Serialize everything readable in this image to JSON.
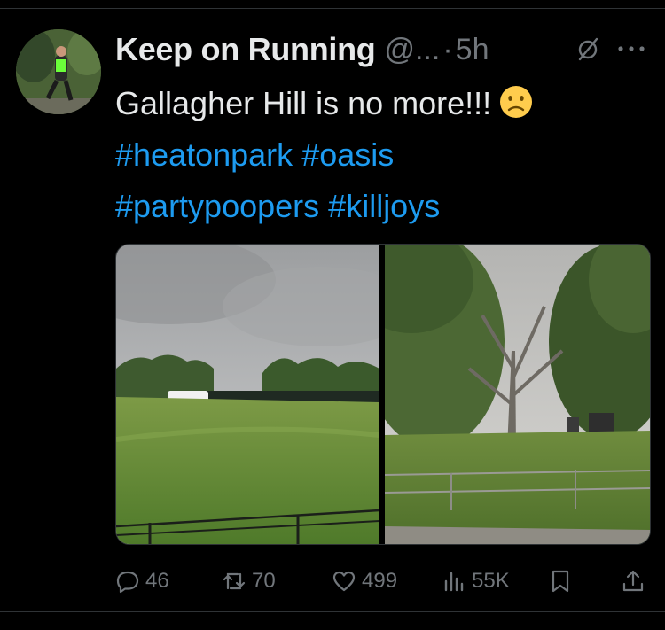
{
  "author": {
    "display_name": "Keep on Running",
    "handle": "@...",
    "separator": "·",
    "time": "5h"
  },
  "tweet": {
    "text": "Gallagher Hill is no more!!!",
    "emoji": "slightly-frowning-face",
    "hashtags": [
      "#heatonpark",
      "#oasis",
      "#partypoopers",
      "#killjoys"
    ]
  },
  "media": {
    "count": 2,
    "photos": [
      "park-field-photo",
      "park-trees-photo"
    ]
  },
  "actions": {
    "reply": {
      "icon": "reply-icon",
      "count": "46"
    },
    "repost": {
      "icon": "repost-icon",
      "count": "70"
    },
    "like": {
      "icon": "heart-icon",
      "count": "499"
    },
    "views": {
      "icon": "views-icon",
      "count": "55K"
    },
    "bookmark": {
      "icon": "bookmark-icon"
    },
    "share": {
      "icon": "share-icon"
    }
  },
  "colors": {
    "background": "#000000",
    "text": "#e7e9ea",
    "muted": "#71767b",
    "link": "#1d9bf0",
    "divider": "#2f3336"
  }
}
